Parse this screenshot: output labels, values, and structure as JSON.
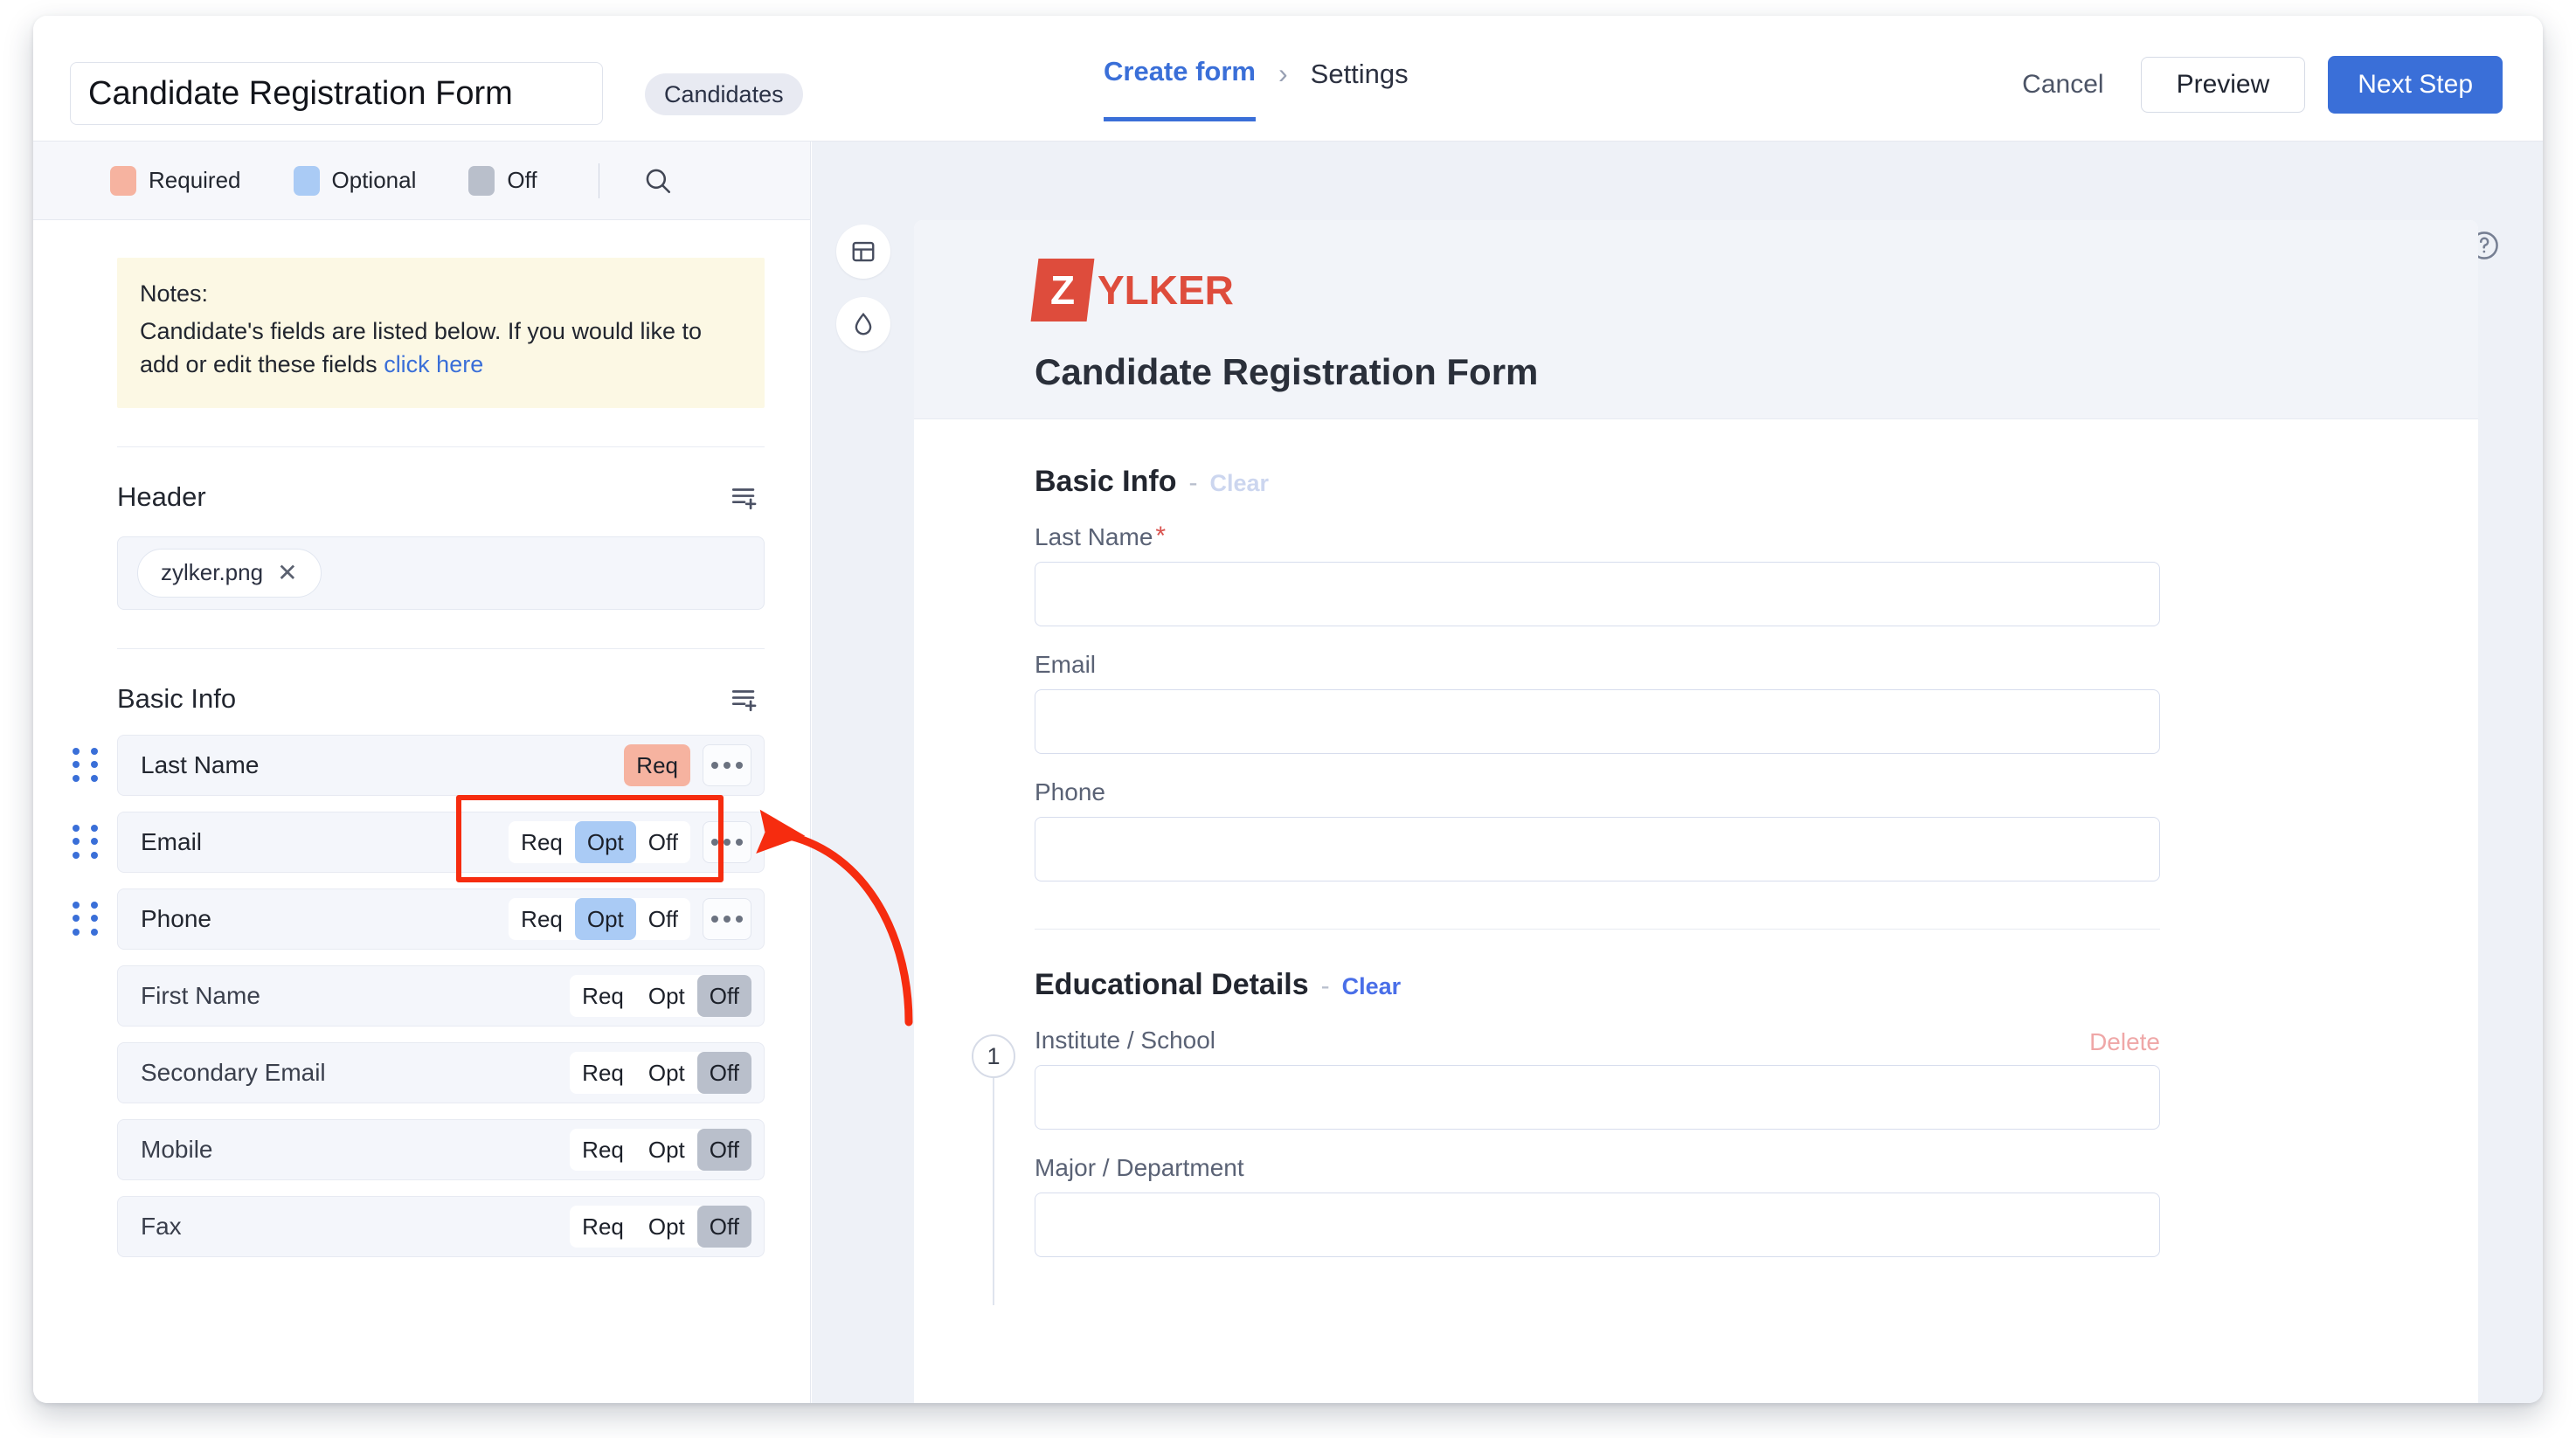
{
  "topbar": {
    "form_title_value": "Candidate Registration Form",
    "form_title_placeholder": "Form name",
    "module_chip": "Candidates",
    "breadcrumb": {
      "current": "Create form",
      "separator": "›",
      "next": "Settings"
    },
    "cancel_label": "Cancel",
    "preview_label": "Preview",
    "next_step_label": "Next Step"
  },
  "left_panel": {
    "legend": [
      {
        "label": "Required",
        "color": "#f6b3a0",
        "icon": "required-swatch"
      },
      {
        "label": "Optional",
        "color": "#aacbf5",
        "icon": "optional-swatch"
      },
      {
        "label": "Off",
        "color": "#b9bfcb",
        "icon": "off-swatch"
      }
    ],
    "search_icon": "search-icon",
    "notes": {
      "title": "Notes:",
      "text": "Candidate's fields are listed below. If you would like to add or edit these fields ",
      "link": "click here"
    },
    "sections": [
      {
        "title": "Header",
        "add_icon": "add-field-icon",
        "file_chip": {
          "label": "zylker.png",
          "remove_icon": "close-icon",
          "remove_glyph": "✕"
        }
      },
      {
        "title": "Basic Info",
        "add_icon": "add-field-icon"
      }
    ],
    "segment_labels": {
      "req": "Req",
      "opt": "Opt",
      "off": "Off"
    },
    "fields": [
      {
        "label": "Last Name",
        "state": "req",
        "collapsed": true,
        "draggable": true,
        "has_menu": true
      },
      {
        "label": "Email",
        "state": "opt",
        "collapsed": false,
        "draggable": true,
        "has_menu": true
      },
      {
        "label": "Phone",
        "state": "opt",
        "collapsed": false,
        "draggable": true,
        "has_menu": true
      },
      {
        "label": "First Name",
        "state": "off",
        "collapsed": false,
        "draggable": false,
        "has_menu": false
      },
      {
        "label": "Secondary Email",
        "state": "off",
        "collapsed": false,
        "draggable": false,
        "has_menu": false
      },
      {
        "label": "Mobile",
        "state": "off",
        "collapsed": false,
        "draggable": false,
        "has_menu": false
      },
      {
        "label": "Fax",
        "state": "off",
        "collapsed": false,
        "draggable": false,
        "has_menu": false
      }
    ]
  },
  "rail": {
    "layout_icon": "layout-icon",
    "theme_icon": "water-drop-icon"
  },
  "preview": {
    "help_icon": "help-circle-icon",
    "logo": {
      "mark_letter": "Z",
      "word": "YLKER",
      "color": "#de4c3c"
    },
    "form_title": "Candidate Registration Form",
    "sections": [
      {
        "title": "Basic Info",
        "dash": "-",
        "clear_label": "Clear",
        "clear_state": "muted",
        "fields": [
          {
            "label": "Last Name",
            "required": true,
            "star": "*",
            "value": "",
            "placeholder": ""
          },
          {
            "label": "Email",
            "required": false,
            "star": "",
            "value": "",
            "placeholder": ""
          },
          {
            "label": "Phone",
            "required": false,
            "star": "",
            "value": "",
            "placeholder": ""
          }
        ]
      },
      {
        "title": "Educational Details",
        "dash": "-",
        "clear_label": "Clear",
        "clear_state": "active",
        "row_number": "1",
        "delete_label": "Delete",
        "fields": [
          {
            "label": "Institute / School",
            "required": false,
            "star": "",
            "value": "",
            "placeholder": ""
          },
          {
            "label": "Major / Department",
            "required": false,
            "star": "",
            "value": "",
            "placeholder": ""
          }
        ]
      }
    ]
  },
  "annotations": {
    "highlight_color": "#f62c0f",
    "arrow_color": "#f62c0f",
    "highlight_target": "email-row-segmented-control",
    "arrow_points_to": "email-row-segmented-control"
  }
}
